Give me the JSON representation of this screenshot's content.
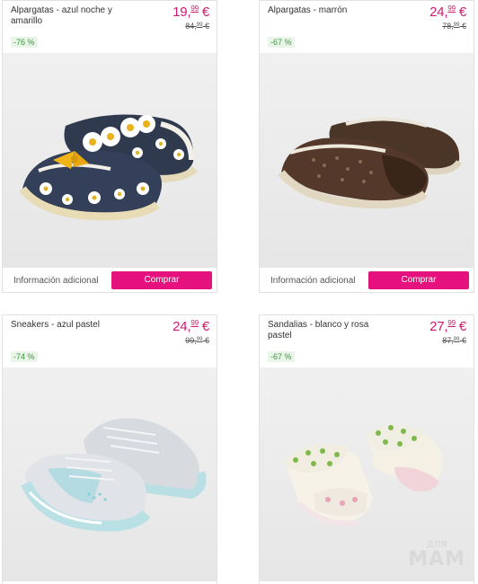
{
  "products": [
    {
      "name": "Alpargatas - azul noche y amarillo",
      "price_int": "19,",
      "price_dec": "99",
      "price_cur": " €",
      "old_int": "84,",
      "old_dec": "99",
      "old_cur": " €",
      "discount": "-76 %",
      "info_label": "Información adicional",
      "buy_label": "Comprar"
    },
    {
      "name": "Alpargatas - marrón",
      "price_int": "24,",
      "price_dec": "99",
      "price_cur": " €",
      "old_int": "78,",
      "old_dec": "99",
      "old_cur": " €",
      "discount": "-67 %",
      "info_label": "Información adicional",
      "buy_label": "Comprar"
    },
    {
      "name": "Sneakers - azul pastel",
      "price_int": "24,",
      "price_dec": "99",
      "price_cur": " €",
      "old_int": "99,",
      "old_dec": "99",
      "old_cur": " €",
      "discount": "-74 %"
    },
    {
      "name": "Sandalias - blanco y rosa pastel",
      "price_int": "27,",
      "price_dec": "99",
      "price_cur": " €",
      "old_int": "87,",
      "old_dec": "99",
      "old_cur": " €",
      "discount": "-67 %"
    }
  ],
  "watermark": {
    "line1": "для",
    "line2": "МАМ"
  },
  "colors": {
    "price": "#d0186f",
    "buy_button": "#e5117c",
    "discount": "#3a9a3a"
  }
}
